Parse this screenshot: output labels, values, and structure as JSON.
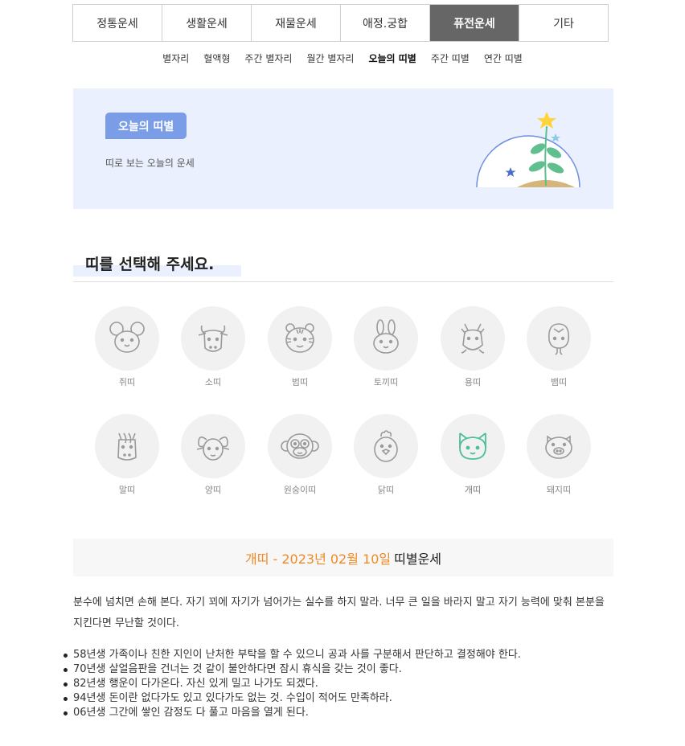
{
  "tabs": [
    {
      "label": "정통운세",
      "active": false
    },
    {
      "label": "생활운세",
      "active": false
    },
    {
      "label": "재물운세",
      "active": false
    },
    {
      "label": "애정.궁합",
      "active": false
    },
    {
      "label": "퓨전운세",
      "active": true
    },
    {
      "label": "기타",
      "active": false
    }
  ],
  "subnav": [
    {
      "label": "별자리",
      "active": false
    },
    {
      "label": "혈액형",
      "active": false
    },
    {
      "label": "주간 별자리",
      "active": false
    },
    {
      "label": "월간 별자리",
      "active": false
    },
    {
      "label": "오늘의 띠별",
      "active": true
    },
    {
      "label": "주간 띠별",
      "active": false
    },
    {
      "label": "연간 띠별",
      "active": false
    }
  ],
  "banner": {
    "badge": "오늘의 띠별",
    "subtitle": "띠로 보는 오늘의 운세"
  },
  "section": {
    "title": "띠를 선택해 주세요."
  },
  "zodiac": [
    {
      "label": "쥐띠",
      "icon": "rat-icon"
    },
    {
      "label": "소띠",
      "icon": "ox-icon"
    },
    {
      "label": "범띠",
      "icon": "tiger-icon"
    },
    {
      "label": "토끼띠",
      "icon": "rabbit-icon"
    },
    {
      "label": "용띠",
      "icon": "dragon-icon"
    },
    {
      "label": "뱀띠",
      "icon": "snake-icon"
    },
    {
      "label": "말띠",
      "icon": "horse-icon"
    },
    {
      "label": "양띠",
      "icon": "sheep-icon"
    },
    {
      "label": "원숭이띠",
      "icon": "monkey-icon"
    },
    {
      "label": "닭띠",
      "icon": "rooster-icon"
    },
    {
      "label": "개띠",
      "icon": "dog-icon",
      "selected": true
    },
    {
      "label": "돼지띠",
      "icon": "pig-icon"
    }
  ],
  "colors": {
    "icon_default": "#9a9a9a",
    "icon_selected": "#4dbf9a",
    "accent_orange": "#f08a24",
    "active_tab": "#666666"
  },
  "result": {
    "highlight": "개띠 - 2023년 02월 10일",
    "title": "띠별운세",
    "description": "분수에 넘치면 손해 본다. 자기 꾀에 자기가 넘어가는 실수를 하지 말라. 너무 큰 일을 바라지 말고 자기 능력에 맞춰 본분을 지킨다면 무난할 것이다.",
    "years": [
      "58년생 가족이나 친한 지인이 난처한 부탁을 할 수 있으니 공과 사를 구분해서 판단하고 결정해야 한다.",
      "70년생 살얼음판을 건너는 것 같이 불안하다면 잠시 휴식을 갖는 것이 좋다.",
      "82년생 행운이 다가온다. 자신 있게 밀고 나가도 되겠다.",
      "94년생 돈이란 없다가도 있고 있다가도 없는 것. 수입이 적어도 만족하라.",
      "06년생 그간에 쌓인 감정도 다 풀고 마음을 열게 된다."
    ]
  }
}
